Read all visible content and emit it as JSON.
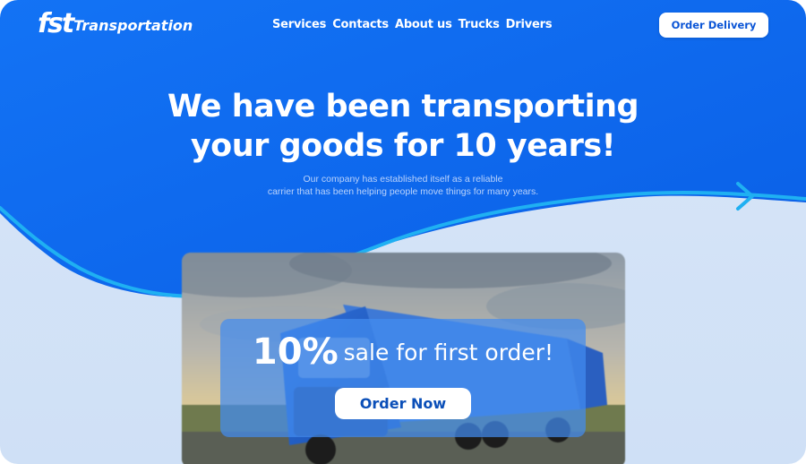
{
  "brand": {
    "logo_mark": "fst",
    "name": "Transportation"
  },
  "nav": {
    "items": [
      {
        "label": "Services"
      },
      {
        "label": "Contacts"
      },
      {
        "label": "About us"
      },
      {
        "label": "Trucks"
      },
      {
        "label": "Drivers"
      }
    ]
  },
  "header": {
    "cta_label": "Order Delivery"
  },
  "hero": {
    "title_line1": "We have been transporting",
    "title_line2": "your goods for 10 years!",
    "subtitle_line1": "Our company has established itself as a reliable",
    "subtitle_line2": "carrier that has been helping people move things for many years."
  },
  "promo": {
    "percent": "10%",
    "text": "sale for first order!",
    "button_label": "Order Now"
  },
  "colors": {
    "primary_blue": "#0f66f0",
    "accent_cyan": "#1aa8f0",
    "light_bg": "#d6e4f7",
    "button_text": "#0b55d6"
  },
  "icons": {
    "next": "arrow-right-icon"
  }
}
